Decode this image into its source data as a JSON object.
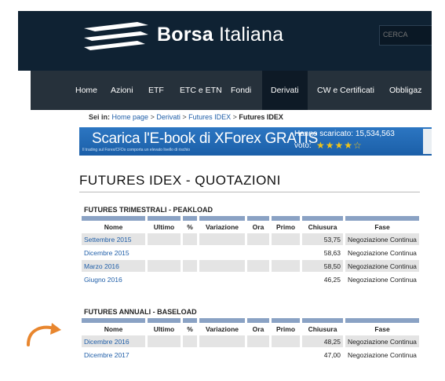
{
  "header": {
    "brand_bold": "Borsa",
    "brand_light": "Italiana",
    "search_placeholder": "CERCA"
  },
  "nav": [
    "Home",
    "Azioni",
    "ETF",
    "ETC e ETN",
    "Fondi",
    "Derivati",
    "CW e Certificati",
    "Obbligaz"
  ],
  "nav_active": "Derivati",
  "breadcrumb": {
    "label": "Sei in:",
    "items": [
      "Home page",
      "Derivati",
      "Futures IDEX"
    ],
    "current": "Futures IDEX"
  },
  "banner": {
    "title": "Scarica l'E-book di XForex GRATIS",
    "small": "Il trading sul Forex/CFDs comporta un elevato livello di rischio",
    "downloads": "Hanno scaricato: 15,534,563",
    "vote": "voto:",
    "stars": "★★★★☆"
  },
  "page_title": "FUTURES IDEX - QUOTAZIONI",
  "columns": [
    "Nome",
    "Ultimo",
    "%",
    "Variazione",
    "Ora",
    "Primo",
    "Chiusura",
    "Fase"
  ],
  "sections": [
    {
      "title": "FUTURES TRIMESTRALI - PEAKLOAD",
      "rows": [
        {
          "nome": "Settembre 2015",
          "chiusura": "53,75",
          "fase": "Negoziazione Continua"
        },
        {
          "nome": "Dicembre 2015",
          "chiusura": "58,63",
          "fase": "Negoziazione Continua"
        },
        {
          "nome": "Marzo 2016",
          "chiusura": "58,50",
          "fase": "Negoziazione Continua"
        },
        {
          "nome": "Giugno 2016",
          "chiusura": "46,25",
          "fase": "Negoziazione Continua"
        }
      ]
    },
    {
      "title": "FUTURES ANNUALI - BASELOAD",
      "rows": [
        {
          "nome": "Dicembre 2016",
          "chiusura": "48,25",
          "fase": "Negoziazione Continua"
        },
        {
          "nome": "Dicembre 2017",
          "chiusura": "47,00",
          "fase": "Negoziazione Continua"
        }
      ]
    }
  ],
  "colors": {
    "header_bg": "#0f2233",
    "nav_bg": "#26313b",
    "link": "#1f5ea8",
    "arrow": "#e8862e",
    "col_bar": "#8aa2c4"
  },
  "annotation": {
    "icon": "curved-arrow-icon"
  }
}
